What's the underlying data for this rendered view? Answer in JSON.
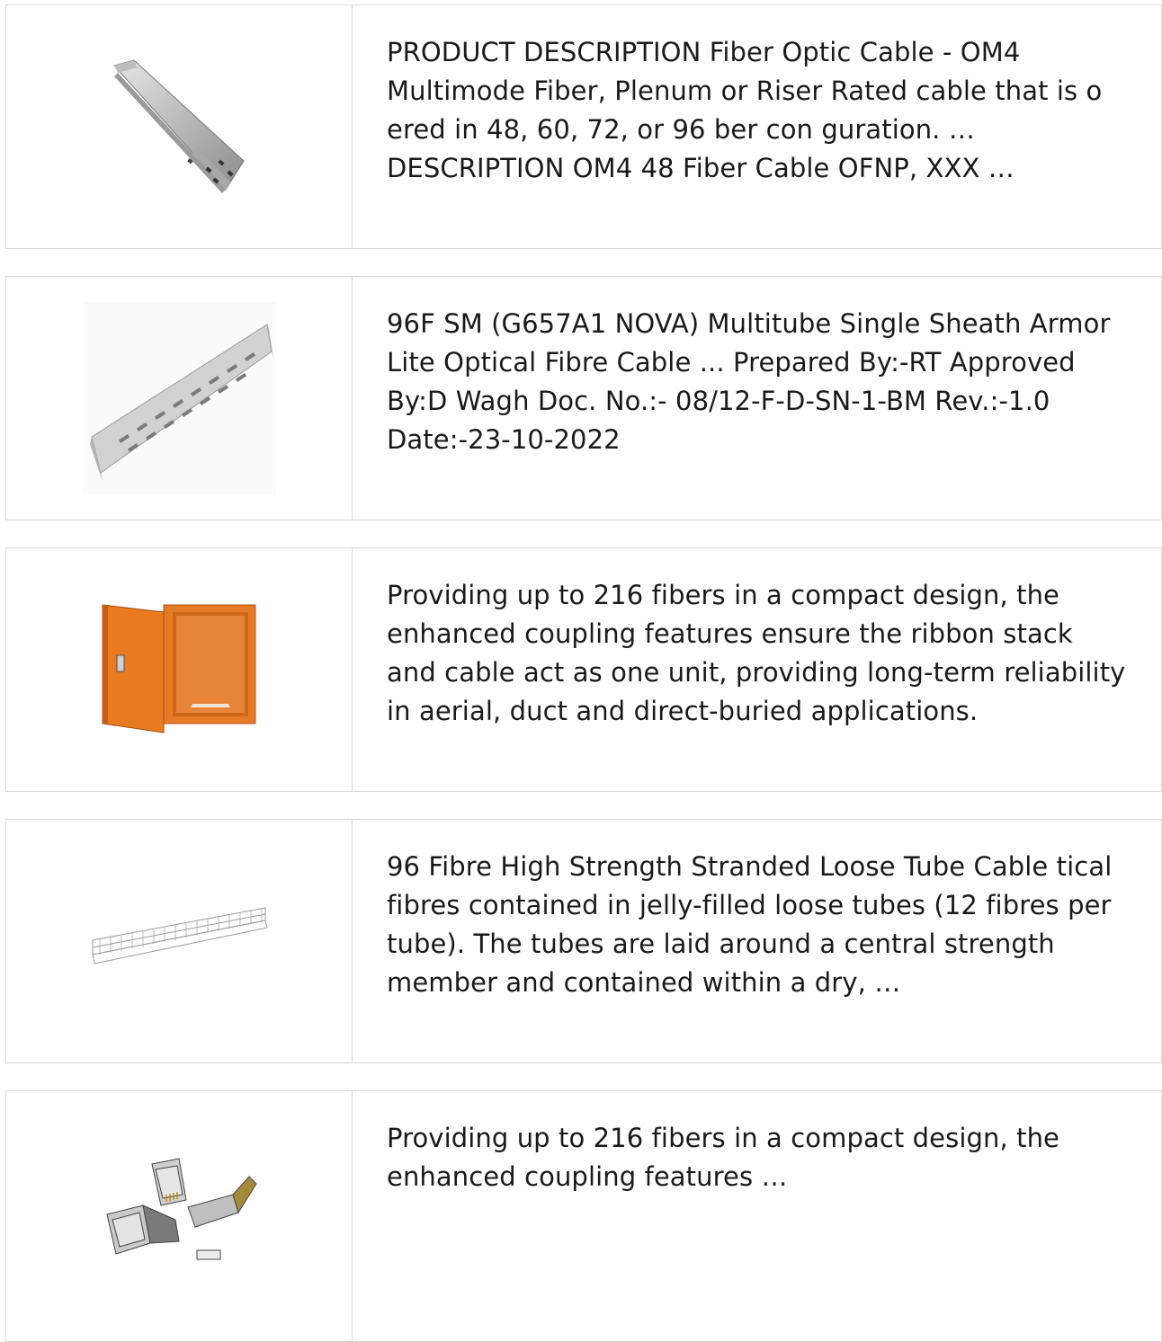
{
  "products": [
    {
      "image": "steel-cable-trunking-cover",
      "description": "PRODUCT DESCRIPTION Fiber Optic Cable - OM4 Multimode Fiber, Plenum or Riser Rated cable that is o ered in 48, 60, 72, or 96 ber con guration. … DESCRIPTION OM4 48 Fiber Cable OFNP, XXX …"
    },
    {
      "image": "perforated-cable-tray",
      "description": "96F SM (G657A1 NOVA) Multitube Single Sheath Armor Lite Optical Fibre Cable ... Prepared By:-RT Approved By:D Wagh Doc. No.:- 08/12-F-D-SN-1-BM Rev.:-1.0 Date:-23-10-2022"
    },
    {
      "image": "orange-electrical-enclosure",
      "description": "Providing up to 216 fibers in a compact design, the enhanced coupling features ensure the ribbon stack and cable act as one unit, providing long-term reliability in aerial, duct and direct-buried applications."
    },
    {
      "image": "wire-mesh-cable-tray",
      "description": "96 Fibre High Strength Stranded Loose Tube Cable tical fibres contained in jelly-filled loose tubes (12 fibres per tube). The tubes are laid around a central strength member and contained within a dry, …"
    },
    {
      "image": "rj45-shielded-connectors",
      "description": "Providing up to 216 fibers in a compact design, the enhanced coupling features …"
    }
  ],
  "colors": {
    "border": "#d9d9d9",
    "text": "#1a1a1a",
    "enclosure": "#e0701e"
  }
}
